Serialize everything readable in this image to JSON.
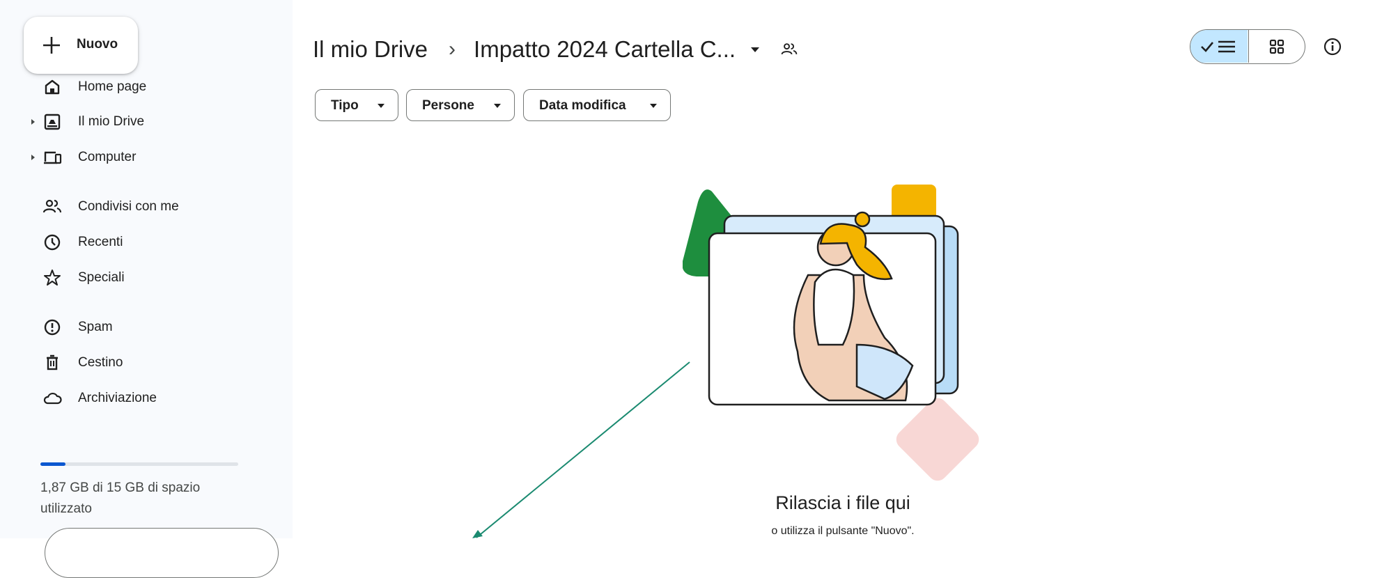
{
  "new_button": {
    "label": "Nuovo",
    "icon": "plus-icon"
  },
  "sidebar": {
    "items": [
      {
        "label": "Home page",
        "icon": "home-icon",
        "expandable": false
      },
      {
        "label": "Il mio Drive",
        "icon": "my-drive-icon",
        "expandable": true
      },
      {
        "label": "Computer",
        "icon": "computer-icon",
        "expandable": true
      },
      {
        "label": "Condivisi con me",
        "icon": "shared-people-icon",
        "expandable": false
      },
      {
        "label": "Recenti",
        "icon": "clock-icon",
        "expandable": false
      },
      {
        "label": "Speciali",
        "icon": "star-icon",
        "expandable": false
      },
      {
        "label": "Spam",
        "icon": "spam-icon",
        "expandable": false
      },
      {
        "label": "Cestino",
        "icon": "trash-icon",
        "expandable": false
      },
      {
        "label": "Archiviazione",
        "icon": "cloud-icon",
        "expandable": false
      }
    ]
  },
  "storage": {
    "used_fraction": 0.125,
    "text": "1,87 GB di 15 GB di spazio utilizzato"
  },
  "breadcrumb": {
    "root": "Il mio Drive",
    "separator": "›",
    "current": "Impatto 2024 Cartella C..."
  },
  "filters": [
    {
      "label": "Tipo"
    },
    {
      "label": "Persone"
    },
    {
      "label": "Data modifica"
    }
  ],
  "view": {
    "selected": "list"
  },
  "empty_state": {
    "title": "Rilascia i file qui",
    "subtitle": "o utilizza il pulsante \"Nuovo\"."
  },
  "colors": {
    "sidebar_bg": "#f8fafd",
    "accent_blue": "#0b57d0",
    "toggle_selected": "#c2e7ff",
    "annotation_arrow": "#1a8a70"
  }
}
